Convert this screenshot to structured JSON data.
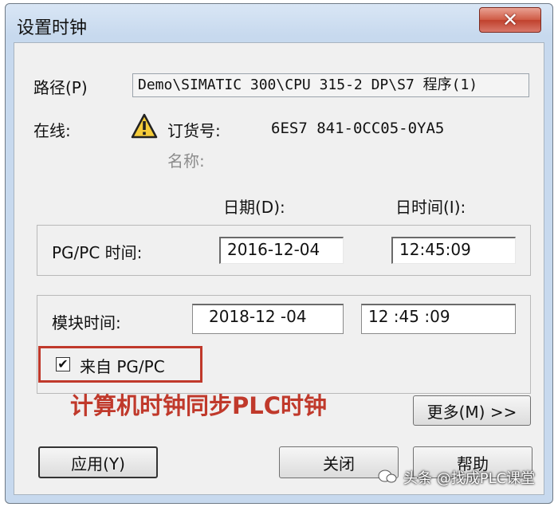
{
  "window": {
    "title": "设置时钟",
    "close_glyph": "✕"
  },
  "path": {
    "label": "路径(P)",
    "value": "Demo\\SIMATIC 300\\CPU 315-2 DP\\S7 程序(1)"
  },
  "online": {
    "label": "在线:",
    "status_icon": "warning-icon",
    "order_label": "订货号:",
    "order_value": "6ES7 841-0CC05-0YA5",
    "name_label": "名称:"
  },
  "columns": {
    "date": "日期(D):",
    "time": "日时间(I):"
  },
  "pgpc": {
    "label": "PG/PC 时间:",
    "date": "2016-12-04",
    "time": "12:45:09"
  },
  "module": {
    "label": "模块时间:",
    "date": "2018-12 -04",
    "time": "12 :45 :09"
  },
  "sync_checkbox": {
    "label": "来自 PG/PC",
    "checked": true,
    "check_glyph": "✔"
  },
  "annotation": "计算机时钟同步PLC时钟",
  "buttons": {
    "more": "更多(M) >>",
    "apply": "应用(Y)",
    "close": "关闭",
    "help": "帮助"
  },
  "watermark": "头条 @找成PLC课堂",
  "colors": {
    "highlight": "#c0392b",
    "title_bar": "#c7d9ee",
    "close_button": "#c0412d"
  }
}
